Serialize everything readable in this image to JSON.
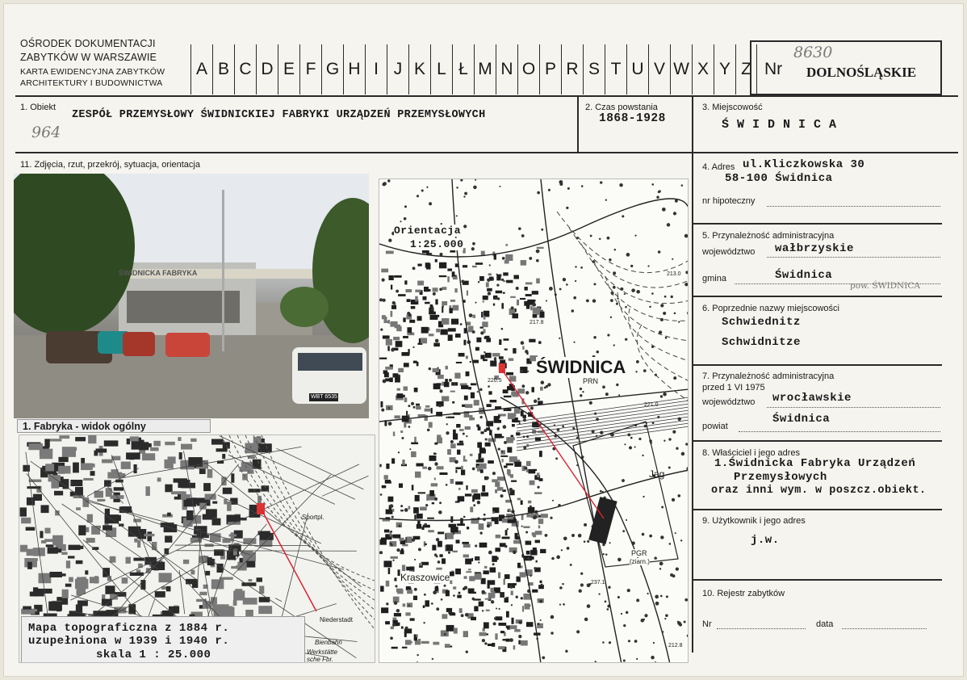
{
  "header": {
    "org_line1": "OŚRODEK DOKUMENTACJI",
    "org_line2": "ZABYTKÓW W WARSZAWIE",
    "org_line3": "KARTA EWIDENCYJNA ZABYTKÓW",
    "org_line4": "ARCHITEKTURY I BUDOWNICTWA",
    "letters": [
      "A",
      "B",
      "C",
      "D",
      "E",
      "F",
      "G",
      "H",
      "I",
      "J",
      "K",
      "L",
      "Ł",
      "M",
      "N",
      "O",
      "P",
      "R",
      "S",
      "T",
      "U",
      "V",
      "W",
      "X",
      "Y",
      "Z"
    ],
    "nr_label": "Nr",
    "nr_handwritten": "8630",
    "region": "DOLNOŚLĄSKIE"
  },
  "fields": {
    "obiekt_label": "1. Obiekt",
    "obiekt_value": "ZESPÓŁ PRZEMYSŁOWY ŚWIDNICKIEJ FABRYKI URZĄDZEŃ PRZEMYSŁOWYCH",
    "obiekt_hand": "964",
    "czas_label": "2. Czas powstania",
    "czas_value": "1868-1928",
    "miejscowosc_label": "3. Miejscowość",
    "miejscowosc_value": "Ś W I D N I C A",
    "zdjecia_label": "11. Zdjęcia, rzut, przekrój, sytuacja, orientacja",
    "adres_label": "4. Adres",
    "adres_line1": "ul.Kliczkowska 30",
    "adres_line2": "58-100 Świdnica",
    "hipoteczny_label": "nr hipoteczny",
    "przynal_label": "5. Przynależność administracyjna",
    "woj_label": "województwo",
    "woj_value": "wałbrzyskie",
    "gmina_label": "gmina",
    "gmina_value": "Świdnica",
    "gmina_hand": "pow. ŚWIDNICA",
    "poprz_label": "6. Poprzednie nazwy miejscowości",
    "poprz_1": "Schwiednitz",
    "poprz_2": "Schwidnitze",
    "przynal7_label": "7. Przynależność administracyjna",
    "przed_label": "przed 1 VI 1975",
    "woj7_label": "województwo",
    "woj7_value": "wrocławskie",
    "powiat_label": "powiat",
    "powiat_value": "Świdnica",
    "wlasciciel_label": "8. Właściciel i jego adres",
    "wlasciciel_1": "1.Świdnicka Fabryka Urządzeń",
    "wlasciciel_2": "Przemysłowych",
    "wlasciciel_3": "oraz inni wym. w poszcz.obiekt.",
    "uzytkownik_label": "9. Użytkownik i jego adres",
    "uzytkownik_value": "j.w.",
    "rejestr_label": "10. Rejestr zabytków",
    "nr_label": "Nr",
    "data_label": "data"
  },
  "photo": {
    "caption": "1. Fabryka - widok ogólny",
    "sign_text": "ŚWIDNICKA FABRYKA",
    "plate": "WBT 6535"
  },
  "map_small": {
    "caption_1": "Mapa topograficzna z 1884 r.",
    "caption_2": "uzupełniona w 1939 i 1940 r.",
    "caption_3": "skala 1 : 25.000",
    "label_sportpl": "Sportpl.",
    "label_niederstadt": "Niederstadt",
    "label_bahn": "Bienbahn",
    "label_werk": "Werkstätte",
    "label_fbr": "sche Fbr."
  },
  "map_large": {
    "orientacja_1": "Orientacja",
    "orientacja_2": "1:25.000",
    "city": "ŚWIDNICA",
    "prn": "PRN",
    "kraszowice": "Kraszowice",
    "jag": "Jag",
    "pgr_1": "PGR",
    "pgr_2": "(ziarn.)",
    "h1": "217.8",
    "h2": "213.0",
    "h3": "220.5",
    "h4": "221.0",
    "h5": "237.1",
    "h6": "212.8"
  }
}
